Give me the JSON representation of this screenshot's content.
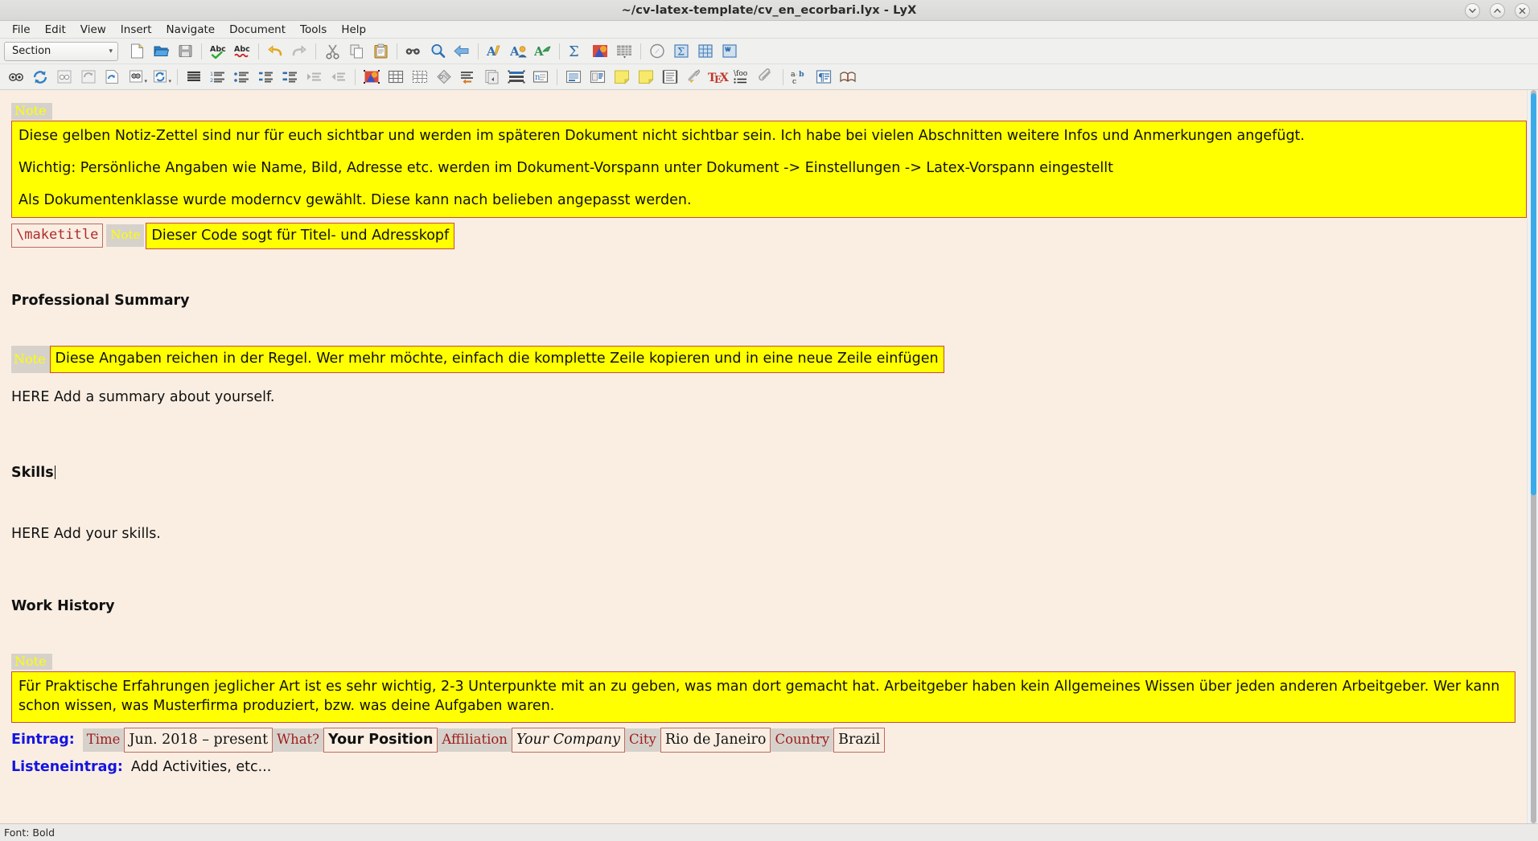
{
  "window": {
    "title": "~/cv-latex-template/cv_en_ecorbari.lyx - LyX",
    "controls": [
      {
        "name": "minimize",
        "glyph": "chevron-down"
      },
      {
        "name": "maximize",
        "glyph": "chevron-up"
      },
      {
        "name": "close",
        "glyph": "cross"
      }
    ]
  },
  "menubar": {
    "items": [
      "File",
      "Edit",
      "View",
      "Insert",
      "Navigate",
      "Document",
      "Tools",
      "Help"
    ]
  },
  "toolbar_main": {
    "layout_combo_value": "Section",
    "buttons": [
      {
        "name": "new-document-icon",
        "title": "New"
      },
      {
        "name": "open-document-icon",
        "title": "Open"
      },
      {
        "name": "save-document-icon",
        "title": "Save"
      },
      {
        "name": "spellcheck-icon",
        "title": "Check spelling"
      },
      {
        "name": "thesaurus-icon",
        "title": "Thesaurus"
      },
      {
        "name": "undo-icon",
        "title": "Undo"
      },
      {
        "name": "redo-icon",
        "title": "Redo"
      },
      {
        "name": "cut-icon",
        "title": "Cut"
      },
      {
        "name": "copy-icon",
        "title": "Copy"
      },
      {
        "name": "paste-icon",
        "title": "Paste"
      },
      {
        "name": "find-replace-icon",
        "title": "Find and replace"
      },
      {
        "name": "zoom-icon",
        "title": "Zoom"
      },
      {
        "name": "back-icon",
        "title": "Navigate back"
      },
      {
        "name": "text-style-icon",
        "title": "Text style"
      },
      {
        "name": "change-tracking-icon",
        "title": "Change tracking"
      },
      {
        "name": "accept-change-icon",
        "title": "Accept change"
      },
      {
        "name": "math-inline-icon",
        "title": "Insert math"
      },
      {
        "name": "graphics-icon",
        "title": "Insert graphics"
      },
      {
        "name": "table-icon",
        "title": "Insert table"
      },
      {
        "name": "navigate-icon",
        "title": "Navigate"
      },
      {
        "name": "math-panel-icon",
        "title": "Math panel"
      },
      {
        "name": "table-panel-icon",
        "title": "Table panel"
      },
      {
        "name": "review-panel-icon",
        "title": "Review toolbar"
      }
    ]
  },
  "toolbar_secondary": {
    "buttons": [
      {
        "name": "view-document-icon",
        "title": "View document"
      },
      {
        "name": "update-document-icon",
        "title": "Update document"
      },
      {
        "name": "view-master-icon",
        "title": "View master document"
      },
      {
        "name": "update-master-icon",
        "title": "Update master document"
      },
      {
        "name": "view-other-format-icon",
        "title": "View other format"
      },
      {
        "name": "view-dropdown-icon",
        "title": "View formats",
        "caret": true
      },
      {
        "name": "update-dropdown-icon",
        "title": "Update formats",
        "caret": true
      },
      {
        "name": "standard-paragraph-icon",
        "title": "Standard paragraph"
      },
      {
        "name": "numbered-list-icon",
        "title": "Numbered list"
      },
      {
        "name": "bullet-list-icon",
        "title": "Itemized list"
      },
      {
        "name": "description-list-icon",
        "title": "Description list"
      },
      {
        "name": "labeling-list-icon",
        "title": "Labeling list"
      },
      {
        "name": "increase-depth-icon",
        "title": "Increase depth"
      },
      {
        "name": "decrease-depth-icon",
        "title": "Decrease depth"
      },
      {
        "name": "insert-graphics-icon",
        "title": "Insert graphics"
      },
      {
        "name": "insert-table-icon",
        "title": "Insert table"
      },
      {
        "name": "insert-table2-icon",
        "title": "Insert table"
      },
      {
        "name": "insert-label-icon",
        "title": "Insert label"
      },
      {
        "name": "insert-footnote-icon",
        "title": "Insert footnote"
      },
      {
        "name": "insert-marginnote-icon",
        "title": "Insert margin note"
      },
      {
        "name": "insert-box-icon",
        "title": "Insert box"
      },
      {
        "name": "insert-nomenclature-icon",
        "title": "Insert nomenclature"
      },
      {
        "name": "insert-float-icon",
        "title": "Insert float"
      },
      {
        "name": "insert-wrapfloat-icon",
        "title": "Insert wrap float"
      },
      {
        "name": "insert-note-icon",
        "title": "Insert note"
      },
      {
        "name": "insert-note2-icon",
        "title": "Insert note"
      },
      {
        "name": "insert-listing-icon",
        "title": "Insert program listing"
      },
      {
        "name": "insert-hyperlink-icon",
        "title": "Insert hyperlink"
      },
      {
        "name": "insert-tex-code-icon",
        "title": "Insert TeX code"
      },
      {
        "name": "insert-macro-icon",
        "title": "Insert math macro"
      },
      {
        "name": "insert-attachment-icon",
        "title": "Insert file"
      },
      {
        "name": "insert-index-entry-icon",
        "title": "Insert index entry"
      },
      {
        "name": "paragraph-settings-icon",
        "title": "Paragraph settings"
      },
      {
        "name": "insert-bibliography-icon",
        "title": "Insert bibliography"
      }
    ]
  },
  "document": {
    "note1": {
      "label": "Note",
      "paragraphs": [
        "Diese gelben Notiz-Zettel sind nur für euch sichtbar und werden im späteren Dokument nicht sichtbar sein. Ich habe bei vielen Abschnitten weitere Infos und Anmerkungen angefügt.",
        "Wichtig: Persönliche Angaben wie Name, Bild, Adresse etc. werden im Dokument-Vorspann unter Dokument -> Einstellungen -> Latex-Vorspann eingestellt",
        "Als Dokumentenklasse wurde moderncv gewählt. Diese kann nach belieben angepasst werden."
      ]
    },
    "maketitle": {
      "code": "\\maketitle",
      "note_label": "Note",
      "note_text": "Dieser Code sogt für Titel- und Adresskopf"
    },
    "section_summary": {
      "heading": "Professional Summary",
      "note_label": "Note",
      "note_text": "Diese Angaben reichen in der Regel. Wer mehr möchte, einfach die komplette Zeile kopieren und in eine neue Zeile einfügen",
      "body": "HERE Add a summary about yourself."
    },
    "section_skills": {
      "heading": "Skills",
      "body": "HERE Add your skills."
    },
    "section_work": {
      "heading": "Work History",
      "note_label": "Note",
      "note_text": "Für Praktische Erfahrungen jeglicher Art ist es sehr wichtig, 2-3 Unterpunkte mit an zu geben, was man dort gemacht hat. Arbeitgeber haben kein Allgemeines Wissen über jeden anderen Arbeitgeber. Wer kann schon wissen, was Musterfirma produziert, bzw. was deine Aufgaben waren."
    },
    "cv_entry": {
      "row_label": "Eintrag:",
      "fields": [
        {
          "name": "Time",
          "value": "Jun. 2018 – present",
          "style": "normal"
        },
        {
          "name": "What?",
          "value": "Your Position",
          "style": "bold"
        },
        {
          "name": "Affiliation",
          "value": "Your Company",
          "style": "italic"
        },
        {
          "name": "City",
          "value": "Rio de Janeiro",
          "style": "normal"
        },
        {
          "name": "Country",
          "value": "Brazil",
          "style": "normal"
        }
      ]
    },
    "cv_list_entry": {
      "row_label": "Listeneintrag:",
      "value": "Add Activities, etc..."
    }
  },
  "statusbar": {
    "text": "Font: Bold"
  },
  "colors": {
    "note_yellow": "#ffff00",
    "note_border": "#c94a3a",
    "paper": "#faeee2",
    "label_blue": "#1414e0",
    "field_red": "#9e1c1c",
    "scrollbar_thumb": "#3aabe8"
  }
}
